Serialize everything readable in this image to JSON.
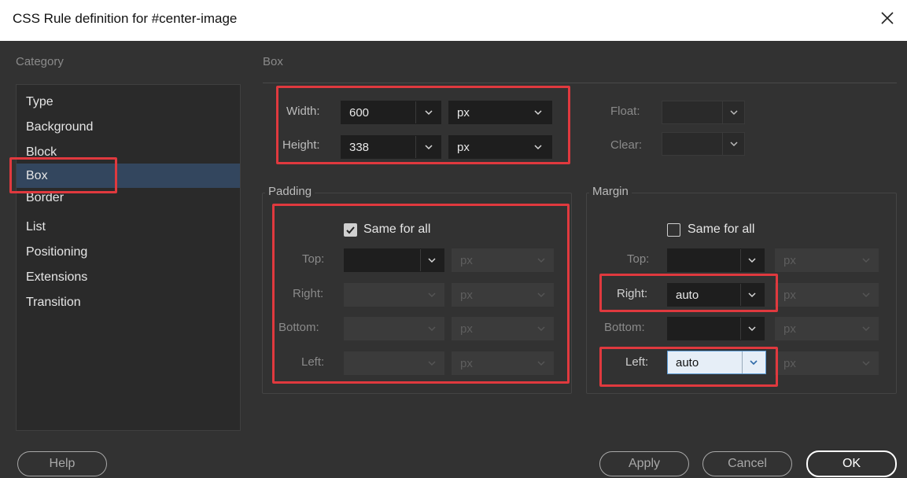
{
  "window": {
    "title": "CSS Rule definition for #center-image",
    "close_icon": "close-icon"
  },
  "category": {
    "label": "Category",
    "items": [
      "Type",
      "Background",
      "Block",
      "Box",
      "Border",
      "List",
      "Positioning",
      "Extensions",
      "Transition"
    ],
    "selected": "Box"
  },
  "box": {
    "section_title": "Box",
    "width": {
      "label": "Width:",
      "value": "600",
      "unit": "px"
    },
    "height": {
      "label": "Height:",
      "value": "338",
      "unit": "px"
    },
    "float": {
      "label": "Float:",
      "value": ""
    },
    "clear": {
      "label": "Clear:",
      "value": ""
    }
  },
  "padding": {
    "title": "Padding",
    "same_for_all": {
      "label": "Same for all",
      "checked": true
    },
    "top": {
      "label": "Top:",
      "value": "",
      "unit": "px"
    },
    "right": {
      "label": "Right:",
      "value": "",
      "unit": "px"
    },
    "bottom": {
      "label": "Bottom:",
      "value": "",
      "unit": "px"
    },
    "left": {
      "label": "Left:",
      "value": "",
      "unit": "px"
    }
  },
  "margin": {
    "title": "Margin",
    "same_for_all": {
      "label": "Same for all",
      "checked": false
    },
    "top": {
      "label": "Top:",
      "value": "",
      "unit": "px"
    },
    "right": {
      "label": "Right:",
      "value": "auto",
      "unit": "px"
    },
    "bottom": {
      "label": "Bottom:",
      "value": "",
      "unit": "px"
    },
    "left": {
      "label": "Left:",
      "value": "auto",
      "unit": "px"
    }
  },
  "buttons": {
    "help": "Help",
    "apply": "Apply",
    "cancel": "Cancel",
    "ok": "OK"
  },
  "colors": {
    "highlight": "#e0393e",
    "selection": "#33465e",
    "background": "#323232"
  }
}
